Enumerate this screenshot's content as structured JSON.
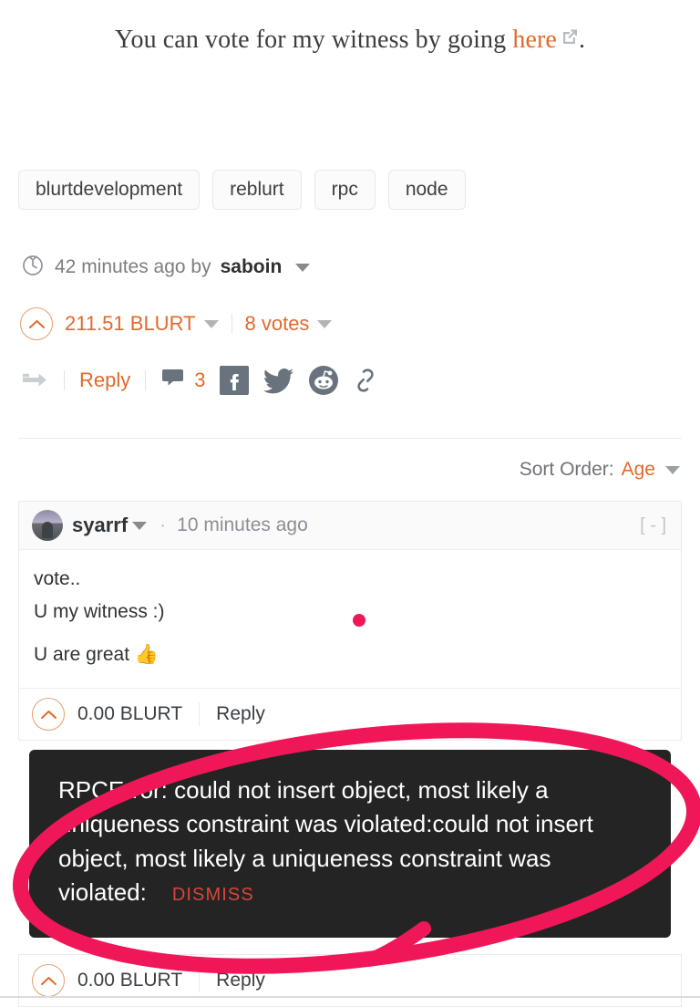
{
  "post": {
    "body_text_before": "You can vote for my witness by going ",
    "link_label": "here",
    "body_text_after": ".",
    "external_link_icon": "external-link-icon"
  },
  "tags": [
    "blurtdevelopment",
    "reblurt",
    "rpc",
    "node"
  ],
  "meta": {
    "clock_icon": "clock-icon",
    "timestamp": "42 minutes ago by",
    "author": "saboin"
  },
  "payout": {
    "upvote_icon": "upvote-chevron-icon",
    "amount": "211.51 BLURT",
    "votes": "8 votes"
  },
  "actions": {
    "reblog_icon": "reblog-arrow-icon",
    "reply_label": "Reply",
    "comment_icon": "comment-bubble-icon",
    "comment_count": "3",
    "facebook_icon": "facebook-icon",
    "twitter_icon": "twitter-icon",
    "reddit_icon": "reddit-icon",
    "link_icon": "link-chain-icon"
  },
  "sort": {
    "label": "Sort Order:",
    "value": "Age",
    "caret_icon": "chevron-down-icon"
  },
  "comment": {
    "avatar": "user-avatar",
    "author": "syarrf",
    "separator": "·",
    "timestamp": "10 minutes ago",
    "collapse_label": "[ - ]",
    "line1": "vote..",
    "line2": "U my witness :)",
    "line3": "U are great 👍",
    "payout": "0.00 BLURT",
    "reply_label": "Reply"
  },
  "comment2": {
    "payout": "0.00 BLURT",
    "reply_label": "Reply"
  },
  "toast": {
    "message": "RPCError: could not insert object, most likely a uniqueness constraint was violated:could not insert object, most likely a uniqueness constraint was violated:",
    "dismiss_label": "DISMISS"
  },
  "colors": {
    "accent_orange": "#e2692c",
    "annotation_red": "#ef1758",
    "toast_bg": "#242424",
    "dismiss_red": "#d9453a",
    "social_gray": "#68737e"
  }
}
